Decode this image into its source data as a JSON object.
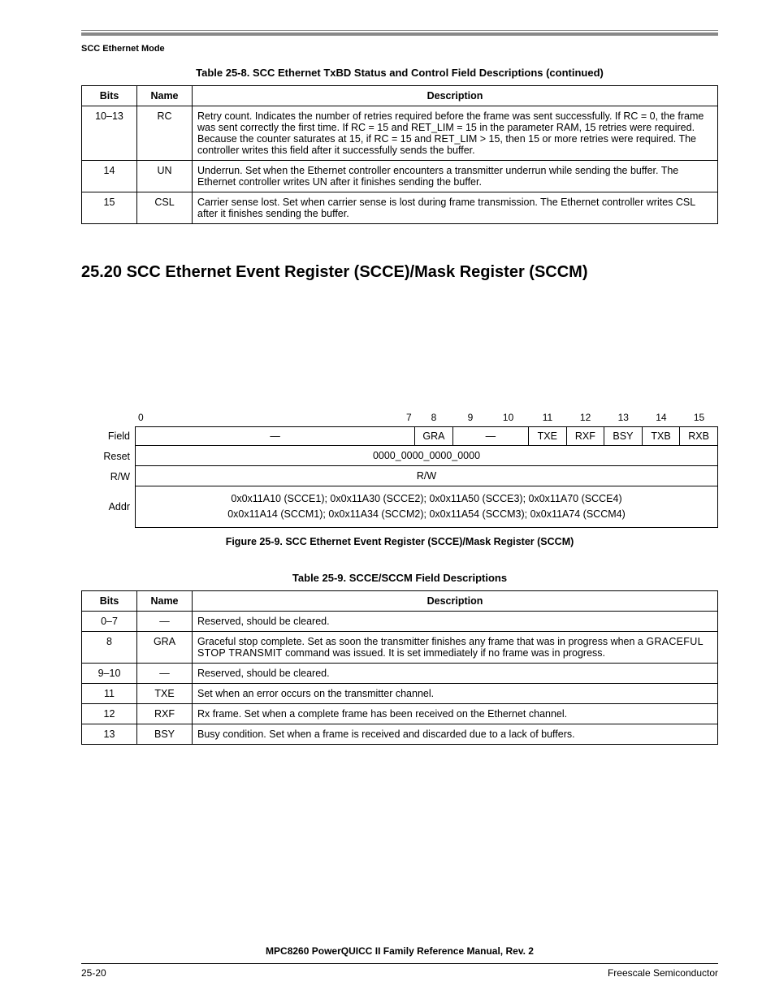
{
  "header": {
    "section": "SCC Ethernet Mode"
  },
  "table1": {
    "caption": "Table 25-8. SCC Ethernet TxBD Status and Control Field Descriptions (continued)",
    "headers": {
      "bits": "Bits",
      "name": "Name",
      "desc": "Description"
    },
    "rows": [
      {
        "bits": "10–13",
        "name": "RC",
        "desc": "Retry count. Indicates the number of retries required before the frame was sent successfully. If RC = 0, the frame was sent correctly the first time. If RC = 15 and RET_LIM = 15 in the parameter RAM, 15 retries were required. Because the counter saturates at 15, if RC = 15 and RET_LIM > 15, then 15 or more retries were required. The controller writes this field after it successfully sends the buffer."
      },
      {
        "bits": "14",
        "name": "UN",
        "desc": "Underrun. Set when the Ethernet controller encounters a transmitter underrun while sending the buffer. The Ethernet controller writes UN after it finishes sending the buffer."
      },
      {
        "bits": "15",
        "name": "CSL",
        "desc": "Carrier sense lost. Set when carrier sense is lost during frame transmission. The Ethernet controller writes CSL after it finishes sending the buffer."
      }
    ]
  },
  "section_heading": "25.20  SCC Ethernet Event Register (SCCE)/Mask Register (SCCM)",
  "register": {
    "bits": {
      "b0": "0",
      "b7": "7",
      "b8": "8",
      "b9": "9",
      "b10": "10",
      "b11": "11",
      "b12": "12",
      "b13": "13",
      "b14": "14",
      "b15": "15"
    },
    "row_labels": {
      "field": "Field",
      "reset": "Reset",
      "rw": "R/W",
      "addr": "Addr"
    },
    "fields": {
      "dash1": "—",
      "gra": "GRA",
      "dash2": "—",
      "txe": "TXE",
      "rxf": "RXF",
      "bsy": "BSY",
      "txb": "TXB",
      "rxb": "RXB"
    },
    "reset_val": "0000_0000_0000_0000",
    "rw_val": "R/W",
    "addr_line1": "0x0x11A10 (SCCE1); 0x0x11A30 (SCCE2); 0x0x11A50 (SCCE3); 0x0x11A70 (SCCE4)",
    "addr_line2": "0x0x11A14 (SCCM1); 0x0x11A34 (SCCM2); 0x0x11A54 (SCCM3); 0x0x11A74 (SCCM4)",
    "caption": "Figure 25-9. SCC Ethernet Event Register (SCCE)/Mask Register (SCCM)"
  },
  "table2": {
    "caption": "Table 25-9. SCCE/SCCM Field Descriptions",
    "headers": {
      "bits": "Bits",
      "name": "Name",
      "desc": "Description"
    },
    "rows": [
      {
        "bits": "0–7",
        "name": "—",
        "desc": "Reserved, should be cleared."
      },
      {
        "bits": "8",
        "name": "GRA",
        "desc_pre": "Graceful stop complete. Set as soon the transmitter finishes any frame that was in progress when a ",
        "desc_smallcaps": "GRACEFUL STOP TRANSMIT",
        "desc_post": " command was issued. It is set immediately if no frame was in progress."
      },
      {
        "bits": "9–10",
        "name": "—",
        "desc": "Reserved, should be cleared."
      },
      {
        "bits": "11",
        "name": "TXE",
        "desc": "Set when an error occurs on the transmitter channel."
      },
      {
        "bits": "12",
        "name": "RXF",
        "desc": "Rx frame. Set when a complete frame has been received on the Ethernet channel."
      },
      {
        "bits": "13",
        "name": "BSY",
        "desc": "Busy condition. Set when a frame is received and discarded due to a lack of buffers."
      }
    ]
  },
  "footer": {
    "title": "MPC8260 PowerQUICC II Family Reference Manual, Rev. 2",
    "page": "25-20",
    "company": "Freescale Semiconductor"
  }
}
